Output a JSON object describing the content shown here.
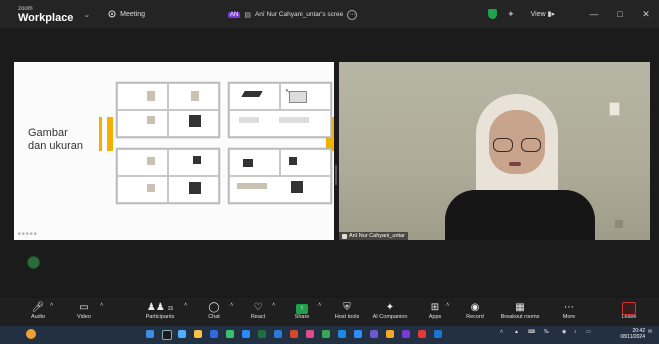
{
  "titlebar": {
    "brand_top": "zoom",
    "brand_main": "Workplace",
    "meeting_label": "Meeting",
    "share_badge": "AN",
    "share_label": "Anī Nur Cahyani_untar's scree",
    "view_label": "View"
  },
  "slide": {
    "title_line1": "Gambar",
    "title_line2": "dan ukuran"
  },
  "video": {
    "participant_name": "Anī Nur Cahyani_untar"
  },
  "toolbar": {
    "audio": "Audio",
    "video": "Video",
    "participants": "Participants",
    "participants_count": "15",
    "chat": "Chat",
    "react": "React",
    "share": "Share",
    "host_tools": "Host tools",
    "ai_companion": "AI Companion",
    "apps": "Apps",
    "record": "Record",
    "breakout": "Breakout rooms",
    "more": "More",
    "leave": "Leave"
  },
  "taskbar": {
    "time": "20:42",
    "date": "08/11/2024"
  },
  "colors": {
    "accent_yellow": "#f2b100",
    "share_green": "#1fa14b",
    "leave_red": "#cc3333",
    "taskbar": "#223042"
  }
}
